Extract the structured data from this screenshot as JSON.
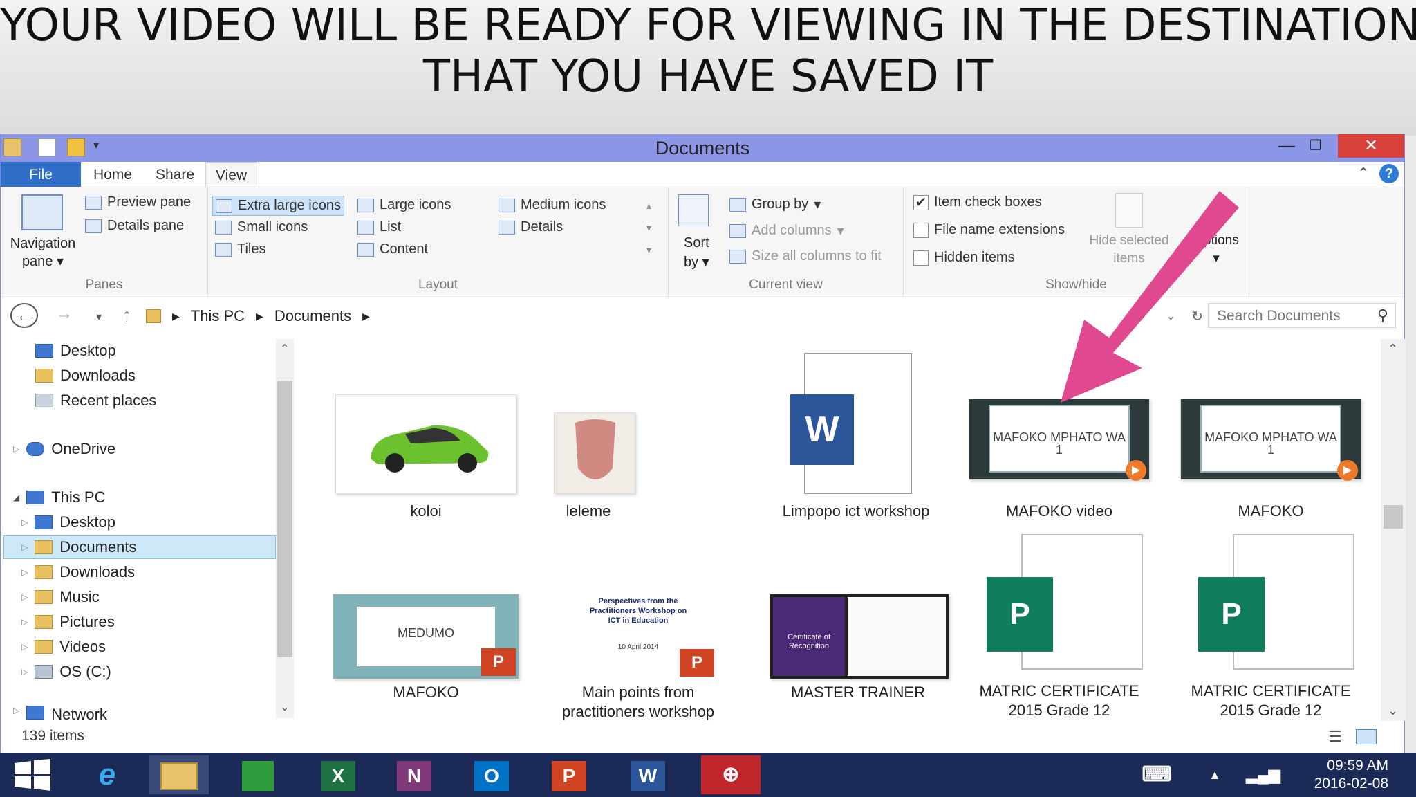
{
  "slide_title": {
    "line1": "YOUR VIDEO WILL BE READY FOR VIEWING IN THE DESTINATION",
    "line2": "THAT YOU HAVE SAVED IT"
  },
  "window": {
    "title": "Documents"
  },
  "tabs": [
    {
      "label": "File"
    },
    {
      "label": "Home"
    },
    {
      "label": "Share"
    },
    {
      "label": "View"
    }
  ],
  "ribbon": {
    "panes": {
      "navigation": "Navigation",
      "navigation2": "pane",
      "preview": "Preview pane",
      "details": "Details pane",
      "label": "Panes"
    },
    "layout": {
      "xl": "Extra large icons",
      "large": "Large icons",
      "medium": "Medium icons",
      "small": "Small icons",
      "list": "List",
      "details": "Details",
      "tiles": "Tiles",
      "content": "Content",
      "label": "Layout"
    },
    "current_view": {
      "sort": "Sort",
      "sort2": "by",
      "group": "Group by",
      "add_cols": "Add columns",
      "size_cols": "Size all columns to fit",
      "label": "Current view"
    },
    "show_hide": {
      "item_check": "Item check boxes",
      "file_ext": "File name extensions",
      "hidden": "Hidden items",
      "hide_sel": "Hide selected",
      "hide_sel2": "items",
      "options": "Options",
      "label": "Show/hide"
    }
  },
  "address": {
    "crumbs": [
      "This PC",
      "Documents"
    ],
    "search_placeholder": "Search Documents"
  },
  "nav_items": {
    "desktop": "Desktop",
    "downloads": "Downloads",
    "recent": "Recent places",
    "onedrive": "OneDrive",
    "thispc": "This PC",
    "pc_desktop": "Desktop",
    "pc_documents": "Documents",
    "pc_downloads": "Downloads",
    "pc_music": "Music",
    "pc_pictures": "Pictures",
    "pc_videos": "Videos",
    "pc_os": "OS (C:)",
    "network": "Network"
  },
  "files": {
    "f1": "koloi",
    "f2": "leleme",
    "f3": "Limpopo ict workshop",
    "f4": "MAFOKO video",
    "f5": "MAFOKO",
    "f6": "MAFOKO",
    "f7a": "Main points from",
    "f7b": "practitioners workshop",
    "f8": "MASTER TRAINER",
    "f9a": "MATRIC CERTIFICATE",
    "f9b": "2015 Grade 12",
    "f10a": "MATRIC CERTIFICATE",
    "f10b": "2015 Grade 12"
  },
  "thumb_text": {
    "vid": "MAFOKO MPHATO WA 1",
    "medumo": "MEDUMO",
    "perspectives": "Perspectives from the Practitioners Workshop on ICT in Education",
    "perspectives_date": "10 April 2014",
    "cert": "Certificate of Recognition"
  },
  "status": {
    "count": "139 items"
  },
  "taskbar": {
    "time": "09:59 AM",
    "date": "2016-02-08"
  },
  "colors": {
    "arrow": "#e0488f",
    "titlebar": "#8b97e6",
    "taskbar": "#1b2a57"
  }
}
